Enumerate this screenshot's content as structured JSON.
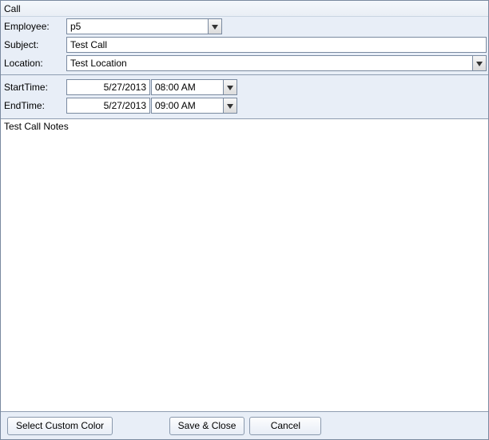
{
  "window": {
    "title": "Call"
  },
  "fields": {
    "employee": {
      "label": "Employee:",
      "value": "p5"
    },
    "subject": {
      "label": "Subject:",
      "value": "Test Call"
    },
    "location": {
      "label": "Location:",
      "value": "Test Location"
    },
    "start": {
      "label": "StartTime:",
      "date": "5/27/2013",
      "time": "08:00 AM"
    },
    "end": {
      "label": "EndTime:",
      "date": "5/27/2013",
      "time": "09:00 AM"
    }
  },
  "notes": {
    "value": "Test Call Notes"
  },
  "buttons": {
    "select_color": "Select Custom Color",
    "save_close": "Save & Close",
    "cancel": "Cancel"
  }
}
